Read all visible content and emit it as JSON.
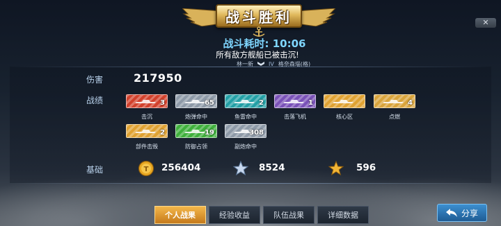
{
  "header": {
    "title": "战斗胜利",
    "close_label": "✕"
  },
  "battle": {
    "time_label": "战斗耗时: 10:06",
    "result": "所有敌方舰船已被击沉!",
    "player_name": "林一新",
    "ship_rank": "IV",
    "ship_name": "格奈森瑙(格)"
  },
  "damage": {
    "label": "伤害",
    "value": "217950"
  },
  "achievements": {
    "label": "战绩",
    "items": [
      {
        "name": "击沉",
        "count": "3",
        "color": "#d2412c",
        "icon": "ship-sinking-icon"
      },
      {
        "name": "炮弹命中",
        "count": "65",
        "color": "#8e9aa8",
        "icon": "shell-icon"
      },
      {
        "name": "鱼雷命中",
        "count": "2",
        "color": "#23a0a6",
        "icon": "torpedo-icon"
      },
      {
        "name": "击落飞机",
        "count": "1",
        "color": "#7a52b8",
        "icon": "aircraft-icon"
      },
      {
        "name": "核心区",
        "count": "",
        "color": "#e0a232",
        "icon": "citadel-icon"
      },
      {
        "name": "点燃",
        "count": "4",
        "color": "#d9a43b",
        "icon": "fire-icon"
      },
      {
        "name": "部件击毁",
        "count": "2",
        "color": "#e0a232",
        "icon": "module-destroy-icon"
      },
      {
        "name": "防御占领",
        "count": "19",
        "color": "#3fb03c",
        "icon": "defend-capture-icon"
      },
      {
        "name": "副炮命中",
        "count": "308",
        "color": "#8e9aa8",
        "icon": "secondary-gun-icon"
      }
    ]
  },
  "basic": {
    "label": "基础",
    "coins": "256404",
    "experience": "8524",
    "captain_exp": "596"
  },
  "tabs": [
    "个人战果",
    "经验收益",
    "队伍战果",
    "详细数据"
  ],
  "share_label": "分享"
}
